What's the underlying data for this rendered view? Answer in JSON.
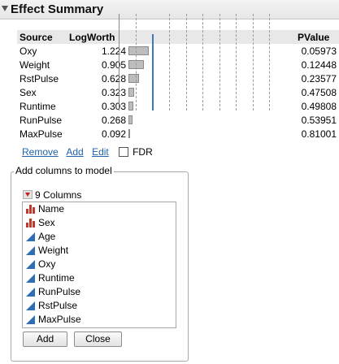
{
  "header": {
    "title": "Effect Summary"
  },
  "table": {
    "columns": {
      "source": "Source",
      "logworth": "LogWorth",
      "pvalue": "PValue"
    },
    "rows": [
      {
        "source": "Oxy",
        "logworth": "1.224",
        "pvalue": "0.05973",
        "bar": 1.224
      },
      {
        "source": "Weight",
        "logworth": "0.905",
        "pvalue": "0.12448",
        "bar": 0.905
      },
      {
        "source": "RstPulse",
        "logworth": "0.628",
        "pvalue": "0.23577",
        "bar": 0.628
      },
      {
        "source": "Sex",
        "logworth": "0.323",
        "pvalue": "0.47508",
        "bar": 0.323
      },
      {
        "source": "Runtime",
        "logworth": "0.303",
        "pvalue": "0.49808",
        "bar": 0.303
      },
      {
        "source": "RunPulse",
        "logworth": "0.268",
        "pvalue": "0.53951",
        "bar": 0.268
      },
      {
        "source": "MaxPulse",
        "logworth": "0.092",
        "pvalue": "0.81001",
        "bar": 0.092
      }
    ]
  },
  "actions": {
    "remove": "Remove",
    "add": "Add",
    "edit": "Edit",
    "fdr": "FDR"
  },
  "add_columns": {
    "title": "Add columns to model",
    "count_label": "9 Columns",
    "items": [
      {
        "label": "Name",
        "icon": "nominal-icon"
      },
      {
        "label": "Sex",
        "icon": "nominal-icon"
      },
      {
        "label": "Age",
        "icon": "continuous-icon"
      },
      {
        "label": "Weight",
        "icon": "continuous-icon"
      },
      {
        "label": "Oxy",
        "icon": "continuous-icon"
      },
      {
        "label": "Runtime",
        "icon": "continuous-icon"
      },
      {
        "label": "RunPulse",
        "icon": "continuous-icon"
      },
      {
        "label": "RstPulse",
        "icon": "continuous-icon"
      },
      {
        "label": "MaxPulse",
        "icon": "continuous-icon"
      }
    ],
    "add_button": "Add",
    "close_button": "Close"
  },
  "colors": {
    "bar": "#bdbdbd",
    "reference_line": "#3c7ab8",
    "link": "#1f63a8",
    "nominal": "#c0392b",
    "continuous": "#2f6db5"
  }
}
